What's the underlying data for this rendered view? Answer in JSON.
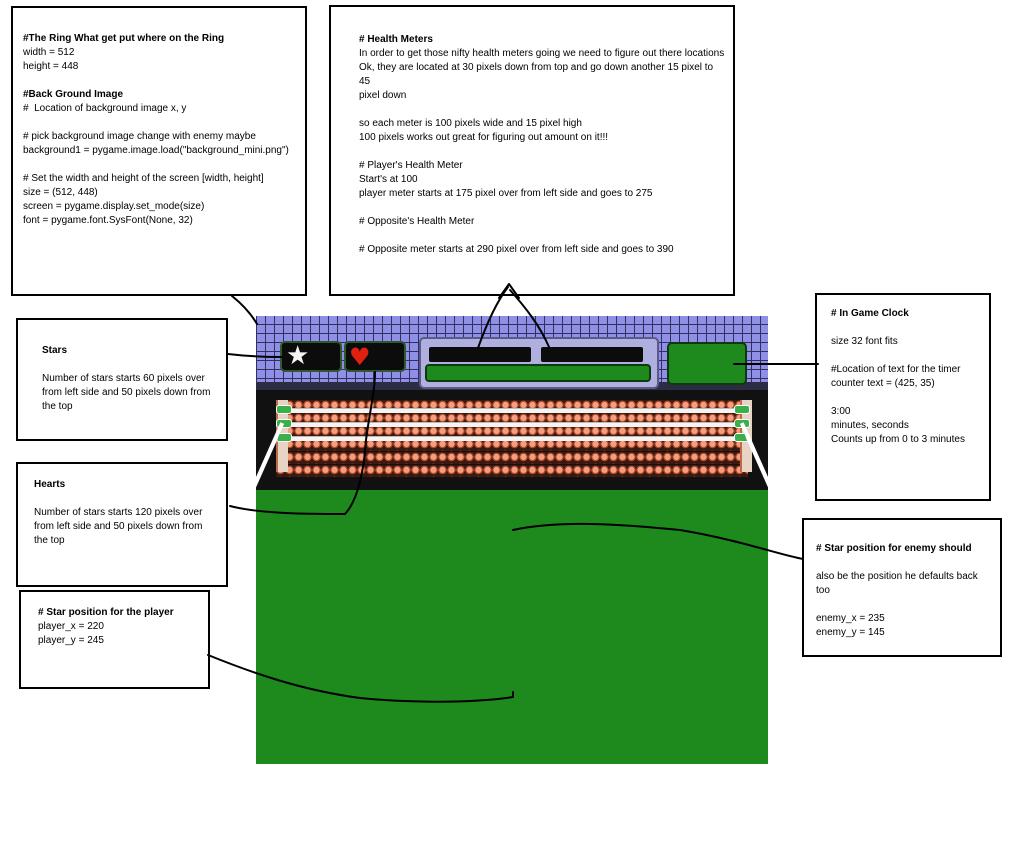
{
  "notes": {
    "ring": {
      "lines": [
        {
          "text": "#The Ring What get put where on the Ring",
          "bold": true
        },
        {
          "text": "width = 512"
        },
        {
          "text": "height = 448"
        },
        {
          "text": " "
        },
        {
          "text": "#Back Ground Image",
          "bold": true
        },
        {
          "text": "#  Location of background image x, y"
        },
        {
          "text": " "
        },
        {
          "text": "# pick background image change with enemy maybe"
        },
        {
          "text": "background1 = pygame.image.load(\"background_mini.png\")"
        },
        {
          "text": " "
        },
        {
          "text": "# Set the width and height of the screen [width, height]"
        },
        {
          "text": "size = (512, 448)"
        },
        {
          "text": "screen = pygame.display.set_mode(size)"
        },
        {
          "text": "font = pygame.font.SysFont(None, 32)"
        }
      ]
    },
    "health": {
      "lines": [
        {
          "text": "# Health Meters",
          "bold": true
        },
        {
          "text": "In order to get those nifty health meters going we need to figure out there locations"
        },
        {
          "text": "Ok, they are located at 30 pixels down from top and go down another 15 pixel to 45"
        },
        {
          "text": "pixel down"
        },
        {
          "text": " "
        },
        {
          "text": "so each meter is 100 pixels wide and 15 pixel high"
        },
        {
          "text": "100 pixels works out great for figuring out amount on it!!!"
        },
        {
          "text": " "
        },
        {
          "text": "# Player's Health Meter"
        },
        {
          "text": "Start's at 100"
        },
        {
          "text": "player meter starts at 175 pixel over from left side and goes to 275"
        },
        {
          "text": " "
        },
        {
          "text": "# Opposite's Health Meter"
        },
        {
          "text": " "
        },
        {
          "text": "# Opposite meter starts at 290 pixel over from left side and goes to 390"
        }
      ]
    },
    "stars": {
      "title": "Stars",
      "body": "Number of stars starts 60 pixels over from left side and 50 pixels down from the top"
    },
    "hearts": {
      "title": "Hearts",
      "body": "Number of stars starts 120 pixels over from left side and 50 pixels down from the top"
    },
    "player": {
      "lines": [
        {
          "text": "# Star position for the player",
          "bold": true
        },
        {
          "text": "player_x = 220"
        },
        {
          "text": "player_y = 245"
        }
      ]
    },
    "clock": {
      "lines": [
        {
          "text": "# In Game Clock",
          "bold": true
        },
        {
          "text": " "
        },
        {
          "text": "size 32 font fits"
        },
        {
          "text": " "
        },
        {
          "text": "#Location of text for the timer"
        },
        {
          "text": "counter text = (425, 35)"
        },
        {
          "text": " "
        },
        {
          "text": "3:00"
        },
        {
          "text": "minutes, seconds"
        },
        {
          "text": "Counts up from 0 to 3 minutes"
        }
      ]
    },
    "enemy": {
      "lines": [
        {
          "text": "# Star position for enemy should",
          "bold": true
        },
        {
          "text": " "
        },
        {
          "text": "also be the position he defaults back too"
        },
        {
          "text": " "
        },
        {
          "text": "enemy_x = 235"
        },
        {
          "text": "enemy_y = 145"
        }
      ]
    }
  },
  "icons": {
    "star": "★",
    "heart": "♥"
  },
  "colors": {
    "ring_floor": "#1e8a1e",
    "hud_green": "#1e8a1e",
    "wall_blue": "#8f8fe8",
    "heart_red": "#e02010",
    "meter_black": "#0c0c0c"
  }
}
